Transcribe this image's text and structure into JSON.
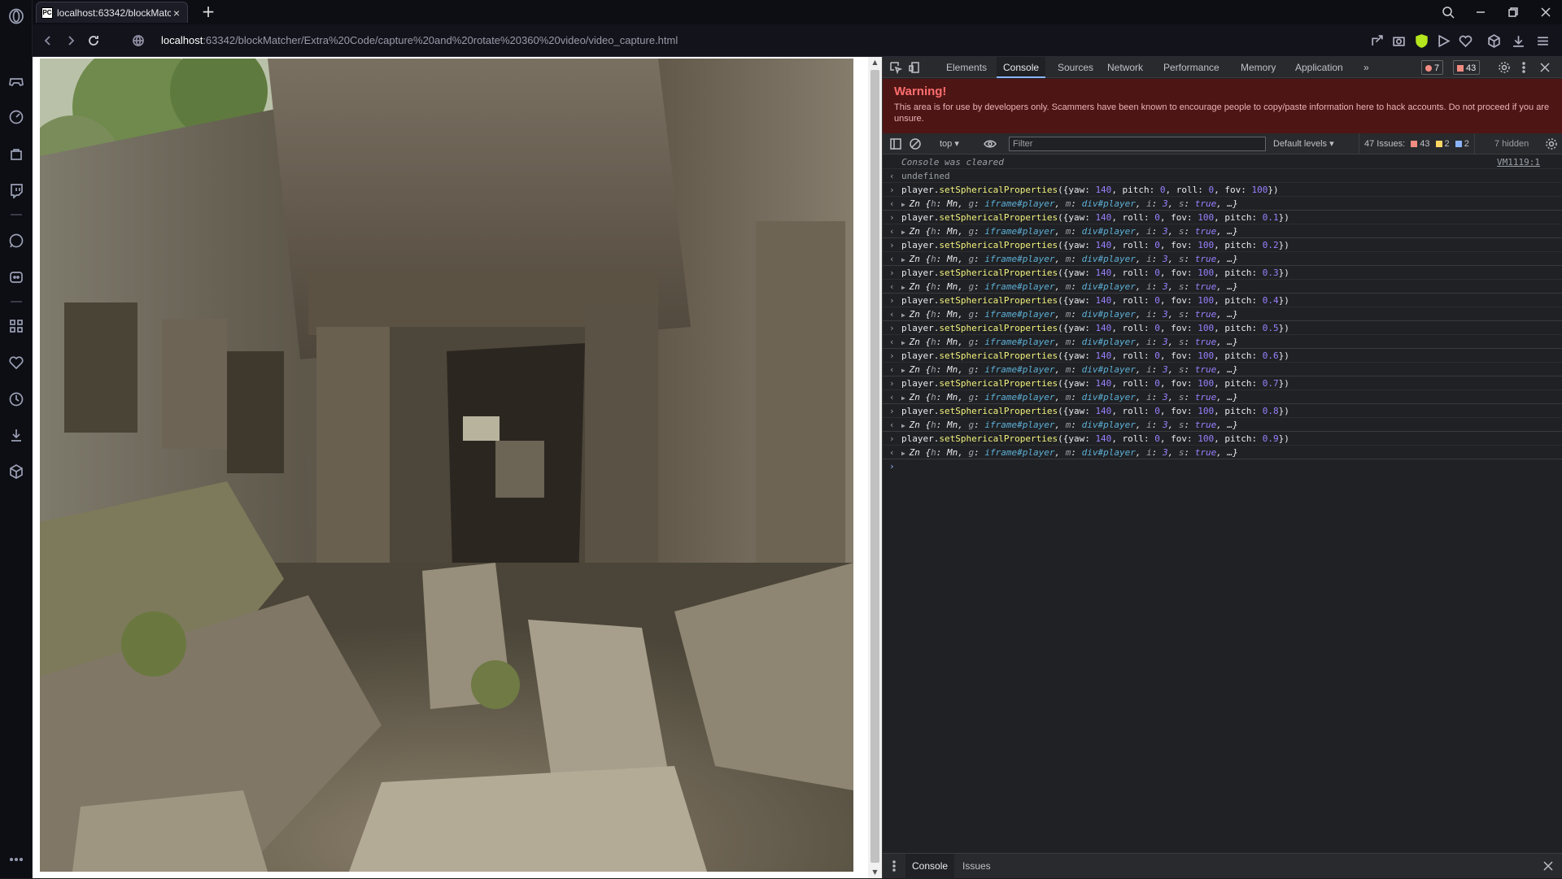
{
  "browser": {
    "tab_title": "localhost:63342/blockMatc",
    "tab_favicon": "PC",
    "url_host": "localhost",
    "url_rest": ":63342/blockMatcher/Extra%20Code/capture%20and%20rotate%20360%20video/video_capture.html"
  },
  "devtools": {
    "tabs": [
      "Elements",
      "Console",
      "Sources",
      "Network",
      "Performance",
      "Memory",
      "Application"
    ],
    "active_tab": "Console",
    "error_count": "7",
    "issue_count": "43",
    "warning_title": "Warning!",
    "warning_text": "This area is for use by developers only. Scammers have been known to encourage people to copy/paste information here to hack accounts. Do not proceed if you are unsure.",
    "context": "top",
    "filter_placeholder": "Filter",
    "levels": "Default levels",
    "issues_label": "47 Issues:",
    "issues_errors": "43",
    "issues_warnings": "2",
    "issues_info": "2",
    "hidden": "7 hidden",
    "drawer_tabs": [
      "Console",
      "Issues"
    ]
  },
  "console": {
    "cleared": "Console was cleared",
    "cleared_link": "VM1119:1",
    "undefined": "undefined",
    "first_cmd": {
      "yaw": "140",
      "pitch": "0",
      "roll": "0",
      "fov": "100"
    },
    "pitch_values": [
      "0.1",
      "0.2",
      "0.3",
      "0.4",
      "0.5",
      "0.6",
      "0.7",
      "0.8",
      "0.9"
    ],
    "result": {
      "h": "Mn",
      "g": "iframe#player",
      "m": "div#player",
      "i": "3",
      "s": "true"
    }
  }
}
